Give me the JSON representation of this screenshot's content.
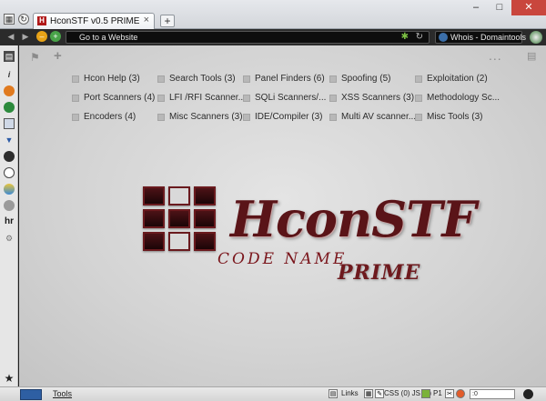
{
  "window": {
    "tab_title": "HconSTF v0.5 PRIME",
    "tab_close": "×",
    "new_tab": "+",
    "minimize": "–",
    "maximize": "□",
    "close": "✕"
  },
  "nav": {
    "back": "◀",
    "forward": "▶",
    "stop_color": "#e8a317",
    "home_color": "#48a348",
    "url_text": "Go to a Website",
    "search_text": "Whois - Domaintools",
    "search_go": "🔍"
  },
  "content_toolbar": {
    "left_icon": "⚑",
    "add_icon": "+",
    "dots": "...",
    "list_icon": "▤"
  },
  "speed_dial": [
    [
      "Hcon Help (3)",
      "Search Tools (3)",
      "Panel Finders (6)",
      "Spoofing (5)",
      "Exploitation (2)"
    ],
    [
      "Port Scanners (4)",
      "LFI /RFI Scanner...",
      "SQLi Scanners/...",
      "XSS Scanners (3)",
      "Methodology Sc..."
    ],
    [
      "Encoders (4)",
      "Misc Scanners (3)",
      "IDE/Compiler (3)",
      "Multi AV scanner...",
      "Misc Tools (3)"
    ]
  ],
  "logo": {
    "title": "HconSTF",
    "codename": "CODE NAME",
    "prime": "PRIME"
  },
  "statusbar": {
    "tools": "Tools",
    "links": "Links",
    "css_js": "CSS (0) JS (0)",
    "p1": "P1",
    "input_value": ":0"
  },
  "colors": {
    "accent": "#6a1a1e",
    "dark_bar": "#2b2b2b"
  }
}
